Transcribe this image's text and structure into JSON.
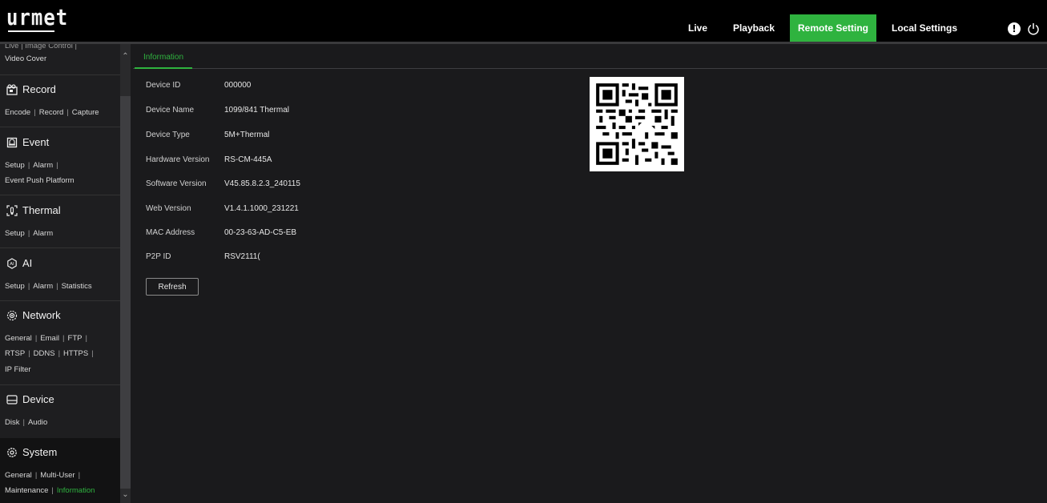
{
  "app": {
    "logo": "urmet"
  },
  "nav": {
    "items": [
      {
        "label": "Live"
      },
      {
        "label": "Playback"
      },
      {
        "label": "Remote Setting"
      },
      {
        "label": "Local Settings"
      }
    ],
    "active_color": "#2fb33f"
  },
  "sidebar": {
    "top_partial": "Live | Image Control |",
    "video_cover": "Video Cover",
    "sections": [
      {
        "title": "Record",
        "icon": "record-icon",
        "lines": [
          [
            "Encode",
            "Record",
            "Capture"
          ]
        ]
      },
      {
        "title": "Event",
        "icon": "event-icon",
        "lines": [
          [
            "Setup",
            "Alarm",
            ""
          ],
          [
            "Event Push Platform"
          ]
        ]
      },
      {
        "title": "Thermal",
        "icon": "thermal-icon",
        "lines": [
          [
            "Setup",
            "Alarm"
          ]
        ]
      },
      {
        "title": "AI",
        "icon": "ai-icon",
        "lines": [
          [
            "Setup",
            "Alarm",
            "Statistics"
          ]
        ]
      },
      {
        "title": "Network",
        "icon": "network-icon",
        "lines": [
          [
            "General",
            "Email",
            "FTP",
            ""
          ],
          [
            "RTSP",
            "DDNS",
            "HTTPS",
            ""
          ],
          [
            "IP Filter"
          ]
        ]
      },
      {
        "title": "Device",
        "icon": "device-icon",
        "lines": [
          [
            "Disk",
            "Audio"
          ]
        ]
      },
      {
        "title": "System",
        "icon": "system-icon",
        "lines": [
          [
            "General",
            "Multi-User",
            ""
          ],
          [
            "Maintenance",
            "Information"
          ]
        ]
      }
    ],
    "active_link": "Information"
  },
  "main": {
    "tab": "Information",
    "fields": [
      {
        "label": "Device ID",
        "value": "000000"
      },
      {
        "label": "Device Name",
        "value": "1099/841 Thermal"
      },
      {
        "label": "Device Type",
        "value": "5M+Thermal"
      },
      {
        "label": "Hardware Version",
        "value": "RS-CM-445A"
      },
      {
        "label": "Software Version",
        "value": "V45.85.8.2.3_240115"
      },
      {
        "label": "Web Version",
        "value": "V1.4.1.1000_231221"
      },
      {
        "label": "MAC Address",
        "value": "00-23-63-AD-C5-EB"
      },
      {
        "label": "P2P ID",
        "value": "RSV2111("
      }
    ],
    "refresh_label": "Refresh",
    "qr_icon": "qr-code"
  }
}
